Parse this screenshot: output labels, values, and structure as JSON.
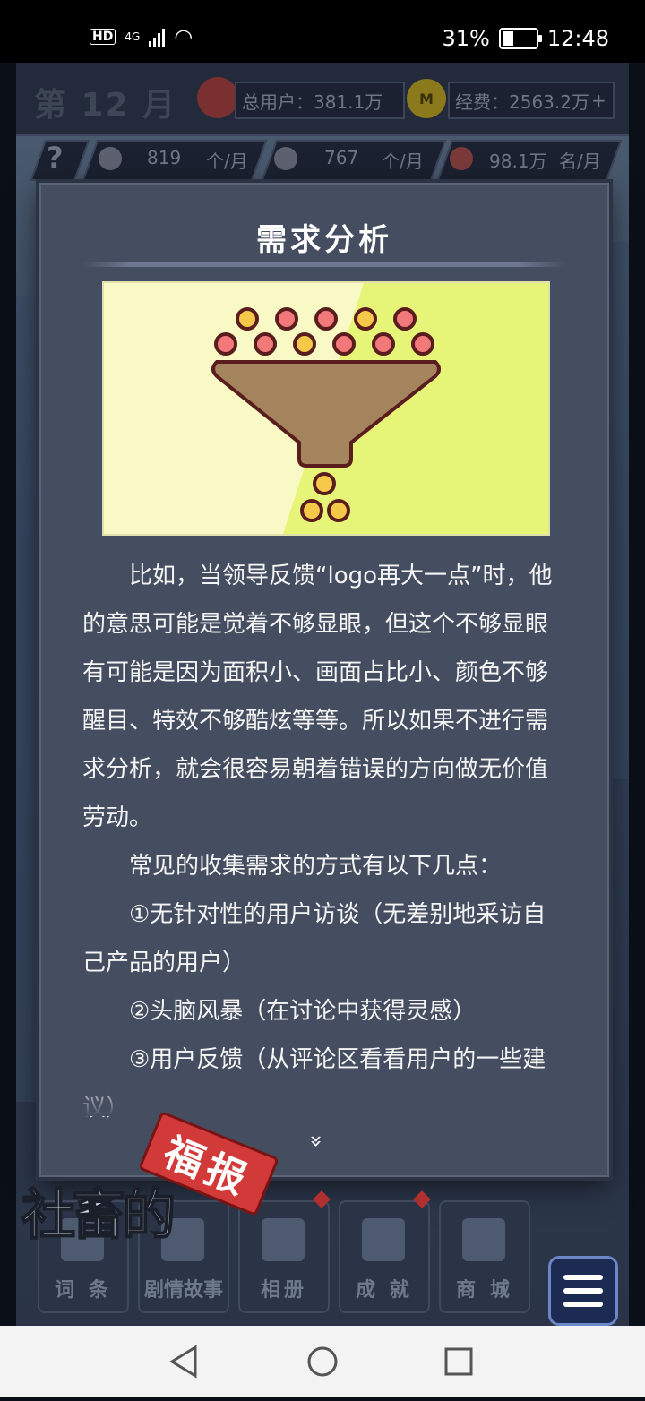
{
  "status_bar": {
    "network": "4G",
    "battery": "31%",
    "battery_level": 0.31,
    "time": "12:48"
  },
  "header": {
    "month": "第 12 月",
    "total_users_label": "总用户：381.1万",
    "funds_label": "经费：2563.2万",
    "funds_add": "+",
    "coin_symbol": "M"
  },
  "stats": {
    "help": "?",
    "ideas_value": "819",
    "ideas_unit": "个/月",
    "tools_value": "767",
    "tools_unit": "个/月",
    "users_value": "98.1万",
    "users_unit": "名/月"
  },
  "modal": {
    "title": "需求分析",
    "paragraphs": [
      "比如，当领导反馈“logo再大一点”时，他的意思可能是觉着不够显眼，但这个不够显眼有可能是因为面积小、画面占比小、颜色不够醒目、特效不够酷炫等等。所以如果不进行需求分析，就会很容易朝着错误的方向做无价值劳动。",
      "常见的收集需求的方式有以下几点：",
      "①无针对性的用户访谈（无差别地采访自己产品的用户）",
      "②头脑风暴（在讨论中获得灵感）",
      "③用户反馈（从评论区看看用户的一些建议）"
    ],
    "more": "»"
  },
  "nav": [
    {
      "label": "词 条"
    },
    {
      "label": "剧情故事"
    },
    {
      "label": "相册"
    },
    {
      "label": "成 就"
    },
    {
      "label": "商 城"
    }
  ],
  "logo": {
    "text": "社畜的",
    "stamp": "福报"
  },
  "colors": {
    "modal_bg": "#454e60",
    "illus_bg": "#f8f9c4",
    "funnel": "#a4845c",
    "ball_pink": "#f2787a",
    "ball_yellow": "#f6c84a",
    "stamp_red": "#d23a3a",
    "menu_blue": "#1c2b52"
  }
}
